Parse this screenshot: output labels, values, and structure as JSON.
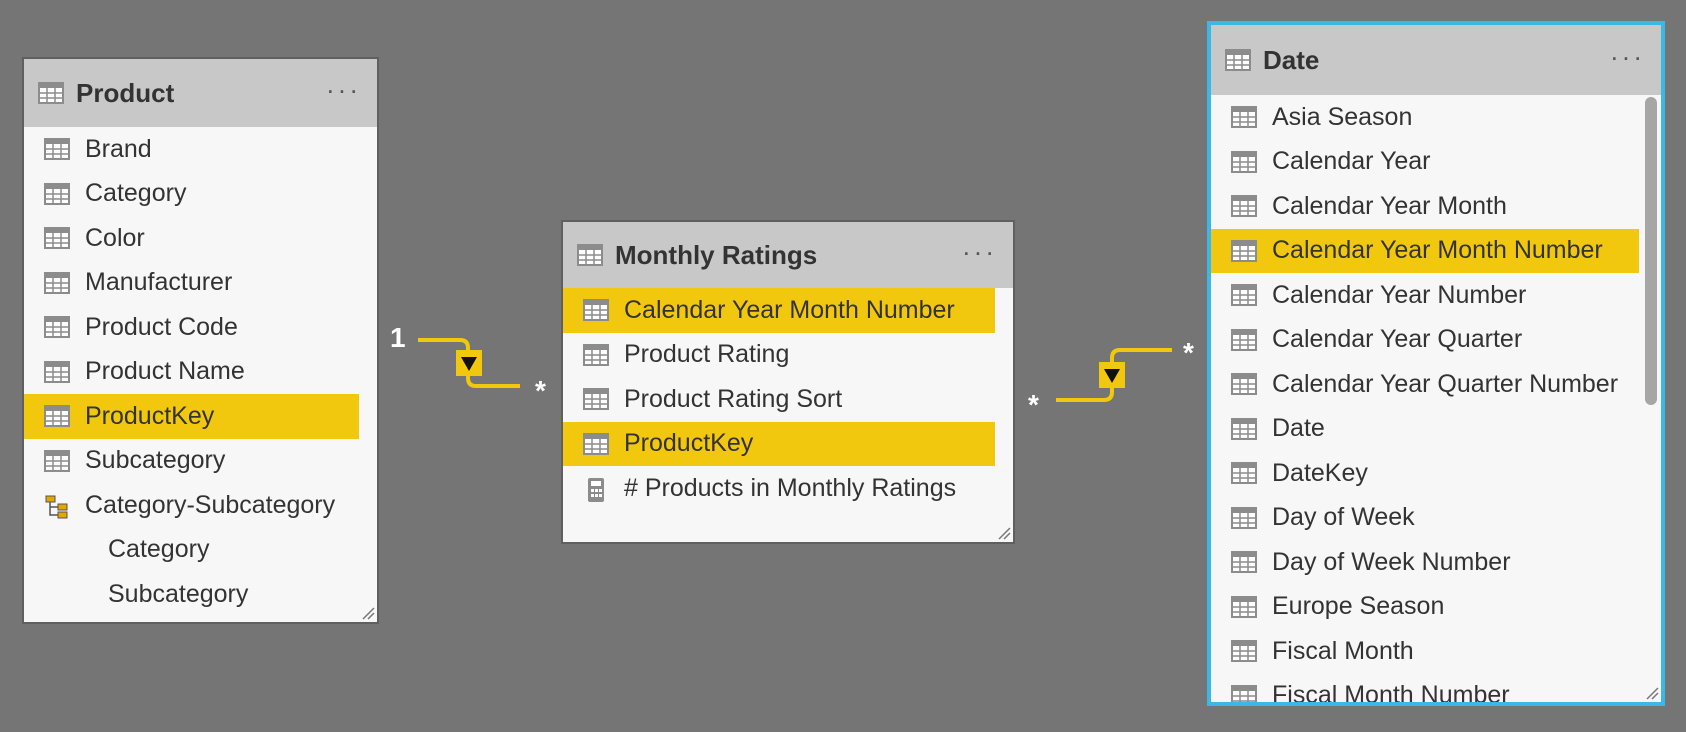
{
  "tables": {
    "product": {
      "title": "Product",
      "menu": "···",
      "fields": [
        "Brand",
        "Category",
        "Color",
        "Manufacturer",
        "Product Code",
        "Product Name",
        "ProductKey",
        "Subcategory",
        "Category-Subcategory"
      ],
      "hierarchy_levels": [
        "Category",
        "Subcategory"
      ]
    },
    "monthly_ratings": {
      "title": "Monthly Ratings",
      "menu": "···",
      "fields": [
        "Calendar Year Month Number",
        "Product Rating",
        "Product Rating Sort",
        "ProductKey",
        "# Products in Monthly Ratings"
      ]
    },
    "date": {
      "title": "Date",
      "menu": "···",
      "fields": [
        "Asia Season",
        "Calendar Year",
        "Calendar Year Month",
        "Calendar Year Month Number",
        "Calendar Year Number",
        "Calendar Year Quarter",
        "Calendar Year Quarter Number",
        "Date",
        "DateKey",
        "Day of Week",
        "Day of Week Number",
        "Europe Season",
        "Fiscal Month",
        "Fiscal Month Number"
      ]
    }
  },
  "relationships": {
    "product_to_ratings": {
      "from_cardinality": "1",
      "to_cardinality": "*"
    },
    "date_to_ratings": {
      "from_cardinality": "*",
      "to_cardinality": "*"
    }
  },
  "colors": {
    "canvas": "#757575",
    "highlight": "#f2c80f",
    "selected_border": "#3cb8e6",
    "header": "#c8c8c8",
    "card_body": "#f7f7f7"
  }
}
